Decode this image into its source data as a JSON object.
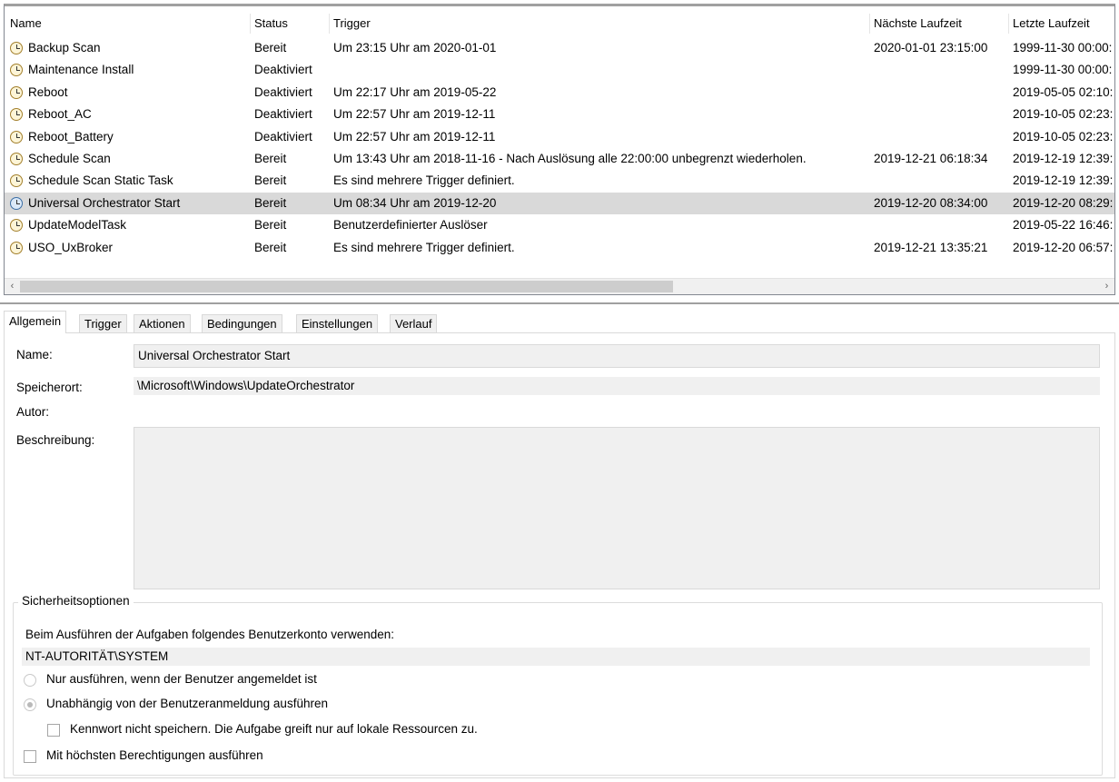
{
  "columns": {
    "name": "Name",
    "status": "Status",
    "trigger": "Trigger",
    "next": "Nächste Laufzeit",
    "last": "Letzte Laufzeit"
  },
  "tasks": [
    {
      "name": "Backup Scan",
      "status": "Bereit",
      "trigger": "Um 23:15 Uhr am 2020-01-01",
      "next": "2020-01-01 23:15:00",
      "last": "1999-11-30 00:00:"
    },
    {
      "name": "Maintenance Install",
      "status": "Deaktiviert",
      "trigger": "",
      "next": "",
      "last": "1999-11-30 00:00:"
    },
    {
      "name": "Reboot",
      "status": "Deaktiviert",
      "trigger": "Um 22:17 Uhr am 2019-05-22",
      "next": "",
      "last": "2019-05-05 02:10:"
    },
    {
      "name": "Reboot_AC",
      "status": "Deaktiviert",
      "trigger": "Um 22:57 Uhr am 2019-12-11",
      "next": "",
      "last": "2019-10-05 02:23:"
    },
    {
      "name": "Reboot_Battery",
      "status": "Deaktiviert",
      "trigger": "Um 22:57 Uhr am 2019-12-11",
      "next": "",
      "last": "2019-10-05 02:23:"
    },
    {
      "name": "Schedule Scan",
      "status": "Bereit",
      "trigger": "Um 13:43 Uhr am 2018-11-16 - Nach Auslösung alle 22:00:00 unbegrenzt wiederholen.",
      "next": "2019-12-21 06:18:34",
      "last": "2019-12-19 12:39:"
    },
    {
      "name": "Schedule Scan Static Task",
      "status": "Bereit",
      "trigger": "Es sind mehrere Trigger definiert.",
      "next": "",
      "last": "2019-12-19 12:39:"
    },
    {
      "name": "Universal Orchestrator Start",
      "status": "Bereit",
      "trigger": "Um 08:34 Uhr am 2019-12-20",
      "next": "2019-12-20 08:34:00",
      "last": "2019-12-20 08:29:"
    },
    {
      "name": "UpdateModelTask",
      "status": "Bereit",
      "trigger": "Benutzerdefinierter Auslöser",
      "next": "",
      "last": "2019-05-22 16:46:"
    },
    {
      "name": "USO_UxBroker",
      "status": "Bereit",
      "trigger": "Es sind mehrere Trigger definiert.",
      "next": "2019-12-21 13:35:21",
      "last": "2019-12-20 06:57:"
    }
  ],
  "scroll": {
    "left": "‹",
    "right": "›"
  },
  "tabs": [
    "Allgemein",
    "Trigger",
    "Aktionen",
    "Bedingungen",
    "Einstellungen",
    "Verlauf"
  ],
  "general": {
    "name_label": "Name:",
    "name_value": "Universal Orchestrator Start",
    "location_label": "Speicherort:",
    "location_value": "\\Microsoft\\Windows\\UpdateOrchestrator",
    "author_label": "Autor:",
    "description_label": "Beschreibung:"
  },
  "security": {
    "title": "Sicherheitsoptionen",
    "account_label": "Beim Ausführen der Aufgaben folgendes Benutzerkonto verwenden:",
    "account_value": "NT-AUTORITÄT\\SYSTEM",
    "radio_logged_on": "Nur ausführen, wenn der Benutzer angemeldet ist",
    "radio_independent": "Unabhängig von der Benutzeranmeldung ausführen",
    "check_no_password": "Kennwort nicht speichern. Die Aufgabe greift nur auf lokale Ressourcen zu.",
    "check_highest": "Mit höchsten Berechtigungen ausführen"
  }
}
